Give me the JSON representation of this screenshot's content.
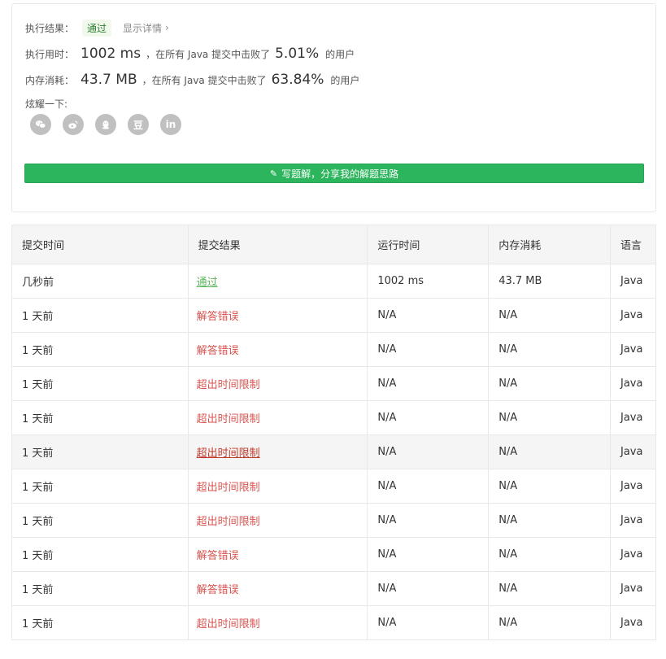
{
  "result": {
    "status_label": "执行结果：",
    "status_value": "通过",
    "detail_link": "显示详情",
    "runtime_label": "执行用时：",
    "runtime_value": "1002 ms",
    "runtime_mid": "，在所有 Java 提交中击败了",
    "runtime_pct": "5.01%",
    "runtime_suffix": "的用户",
    "memory_label": "内存消耗：",
    "memory_value": "43.7 MB",
    "memory_mid": "，在所有 Java 提交中击败了",
    "memory_pct": "63.84%",
    "memory_suffix": "的用户",
    "share_label": "炫耀一下:",
    "share_icons": [
      "wechat-icon",
      "weibo-icon",
      "qq-icon",
      "douban-icon",
      "linkedin-icon"
    ],
    "douban_glyph": "豆",
    "linkedin_glyph": "in",
    "write_button": "写题解，分享我的解题思路"
  },
  "table": {
    "headers": [
      "提交时间",
      "提交结果",
      "运行时间",
      "内存消耗",
      "语言"
    ],
    "rows": [
      {
        "time": "几秒前",
        "result": "通过",
        "runtime": "1002 ms",
        "memory": "43.7 MB",
        "lang": "Java"
      },
      {
        "time": "1 天前",
        "result": "解答错误",
        "runtime": "N/A",
        "memory": "N/A",
        "lang": "Java"
      },
      {
        "time": "1 天前",
        "result": "解答错误",
        "runtime": "N/A",
        "memory": "N/A",
        "lang": "Java"
      },
      {
        "time": "1 天前",
        "result": "超出时间限制",
        "runtime": "N/A",
        "memory": "N/A",
        "lang": "Java"
      },
      {
        "time": "1 天前",
        "result": "超出时间限制",
        "runtime": "N/A",
        "memory": "N/A",
        "lang": "Java"
      },
      {
        "time": "1 天前",
        "result": "超出时间限制",
        "runtime": "N/A",
        "memory": "N/A",
        "lang": "Java"
      },
      {
        "time": "1 天前",
        "result": "超出时间限制",
        "runtime": "N/A",
        "memory": "N/A",
        "lang": "Java"
      },
      {
        "time": "1 天前",
        "result": "超出时间限制",
        "runtime": "N/A",
        "memory": "N/A",
        "lang": "Java"
      },
      {
        "time": "1 天前",
        "result": "解答错误",
        "runtime": "N/A",
        "memory": "N/A",
        "lang": "Java"
      },
      {
        "time": "1 天前",
        "result": "解答错误",
        "runtime": "N/A",
        "memory": "N/A",
        "lang": "Java"
      },
      {
        "time": "1 天前",
        "result": "超出时间限制",
        "runtime": "N/A",
        "memory": "N/A",
        "lang": "Java"
      }
    ]
  },
  "colors": {
    "accepted": "#5cb85c",
    "error": "#d9534f",
    "button": "#2db55d"
  }
}
